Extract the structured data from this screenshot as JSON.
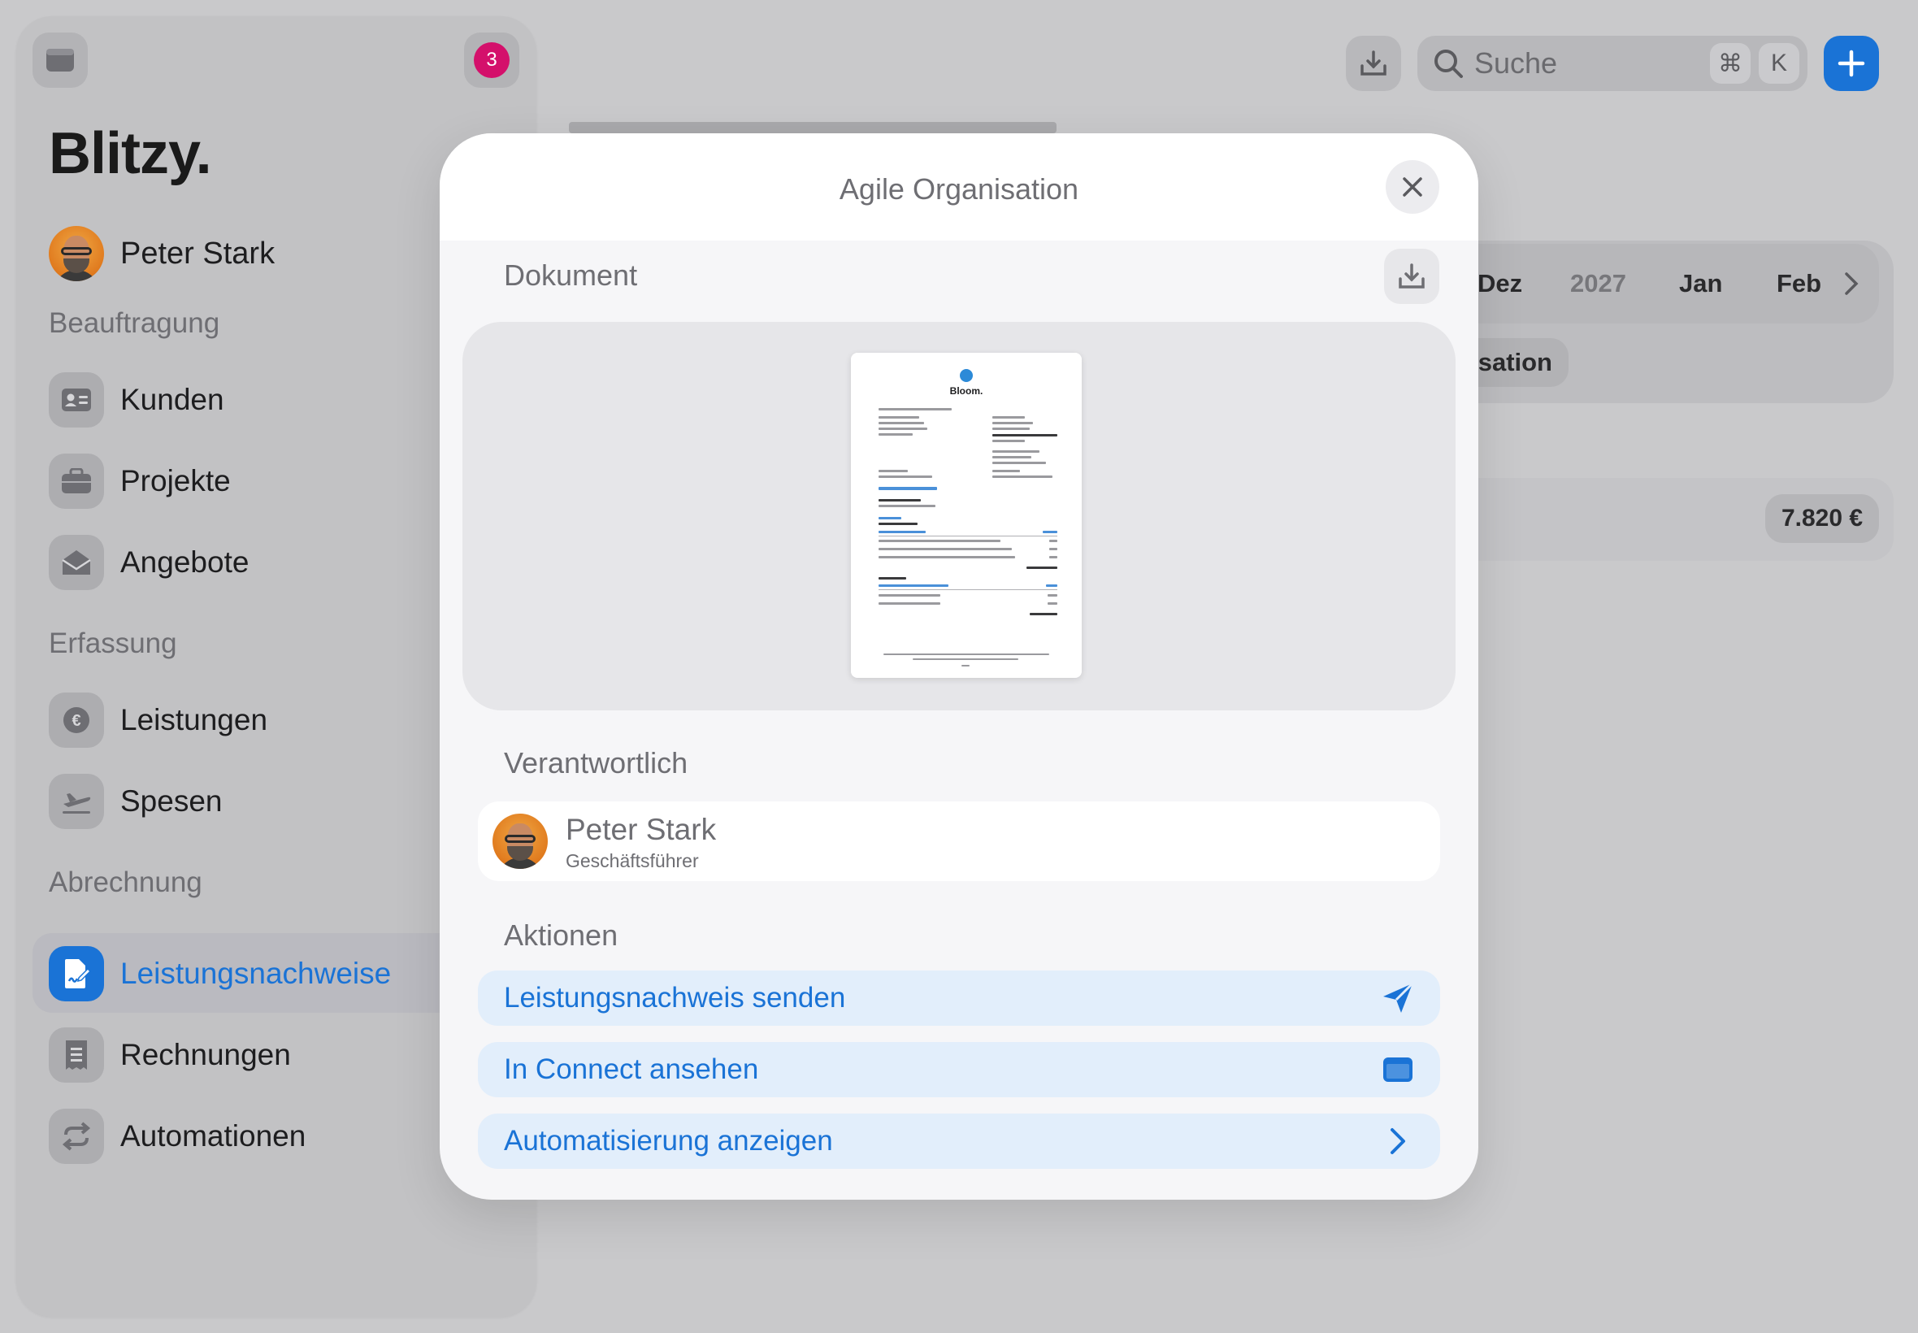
{
  "app": {
    "brand": "Blitzy.",
    "notification_count": "3",
    "user_name": "Peter Stark"
  },
  "sidebar": {
    "sections": [
      {
        "title": "Beauftragung",
        "items": [
          {
            "label": "Kunden",
            "icon": "contact-card-icon"
          },
          {
            "label": "Projekte",
            "icon": "briefcase-icon"
          },
          {
            "label": "Angebote",
            "icon": "envelope-open-icon"
          }
        ]
      },
      {
        "title": "Erfassung",
        "items": [
          {
            "label": "Leistungen",
            "icon": "euro-icon"
          },
          {
            "label": "Spesen",
            "icon": "airplane-icon"
          }
        ]
      },
      {
        "title": "Abrechnung",
        "items": [
          {
            "label": "Leistungsnachweise",
            "icon": "signed-document-icon",
            "active": true
          },
          {
            "label": "Rechnungen",
            "icon": "receipt-icon"
          },
          {
            "label": "Automationen",
            "icon": "repeat-icon"
          }
        ]
      }
    ]
  },
  "header": {
    "search_placeholder": "Suche",
    "shortcut_cmd": "⌘",
    "shortcut_key": "K"
  },
  "background": {
    "months": [
      "Dez",
      "2027",
      "Jan",
      "Feb"
    ],
    "filter_pill": "isation",
    "amount": "7.820 €"
  },
  "modal": {
    "title": "Agile Organisation",
    "document_label": "Dokument",
    "document_preview": {
      "brand": "Bloom.",
      "heading": "Leistungsnachweis"
    },
    "responsible_label": "Verantwortlich",
    "responsible": {
      "name": "Peter Stark",
      "role": "Geschäftsführer"
    },
    "actions_label": "Aktionen",
    "actions": [
      {
        "label": "Leistungsnachweis senden",
        "icon": "send-icon"
      },
      {
        "label": "In Connect ansehen",
        "icon": "window-icon"
      },
      {
        "label": "Automatisierung anzeigen",
        "icon": "chevron-right-icon"
      }
    ]
  },
  "colors": {
    "accent": "#1a73d6",
    "badge": "#d4106b",
    "action_bg": "#e2eefb"
  }
}
